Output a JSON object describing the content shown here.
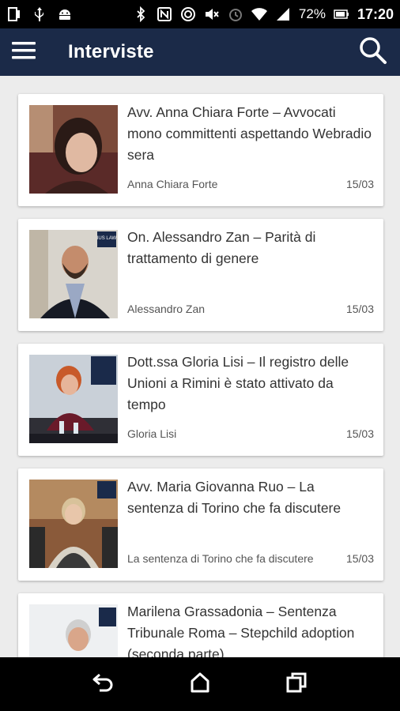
{
  "status_bar": {
    "battery": "72%",
    "time": "17:20",
    "icons_left": [
      "sim-icon",
      "usb-icon",
      "android-icon"
    ],
    "icons_right": [
      "bluetooth-icon",
      "nfc-icon",
      "sync-icon",
      "mute-icon",
      "alarm-icon",
      "wifi-icon",
      "signal-icon",
      "battery-icon"
    ]
  },
  "app_bar": {
    "title": "Interviste",
    "color": "#1b2a48"
  },
  "articles": [
    {
      "title": "Avv. Anna Chiara Forte – Avvocati mono committenti aspettando Webradio sera",
      "author": "Anna Chiara Forte",
      "date": "15/03"
    },
    {
      "title": "On. Alessandro Zan – Parità di trattamento di genere",
      "author": "Alessandro Zan",
      "date": "15/03"
    },
    {
      "title": "Dott.ssa Gloria Lisi – Il registro delle Unioni a Rimini è stato attivato da tempo",
      "author": "Gloria Lisi",
      "date": "15/03"
    },
    {
      "title": "Avv. Maria Giovanna Ruo – La sentenza di Torino che fa discutere",
      "author": "La sentenza di Torino che fa discutere",
      "date": "15/03"
    },
    {
      "title": "Marilena Grassadonia – Sentenza Tribunale Roma – Stepchild adoption (seconda parte)",
      "author": "",
      "date": ""
    }
  ],
  "thumb_badge": "IUS LAW",
  "nav_bar": {
    "buttons": [
      "back-icon",
      "home-icon",
      "recents-icon"
    ]
  }
}
